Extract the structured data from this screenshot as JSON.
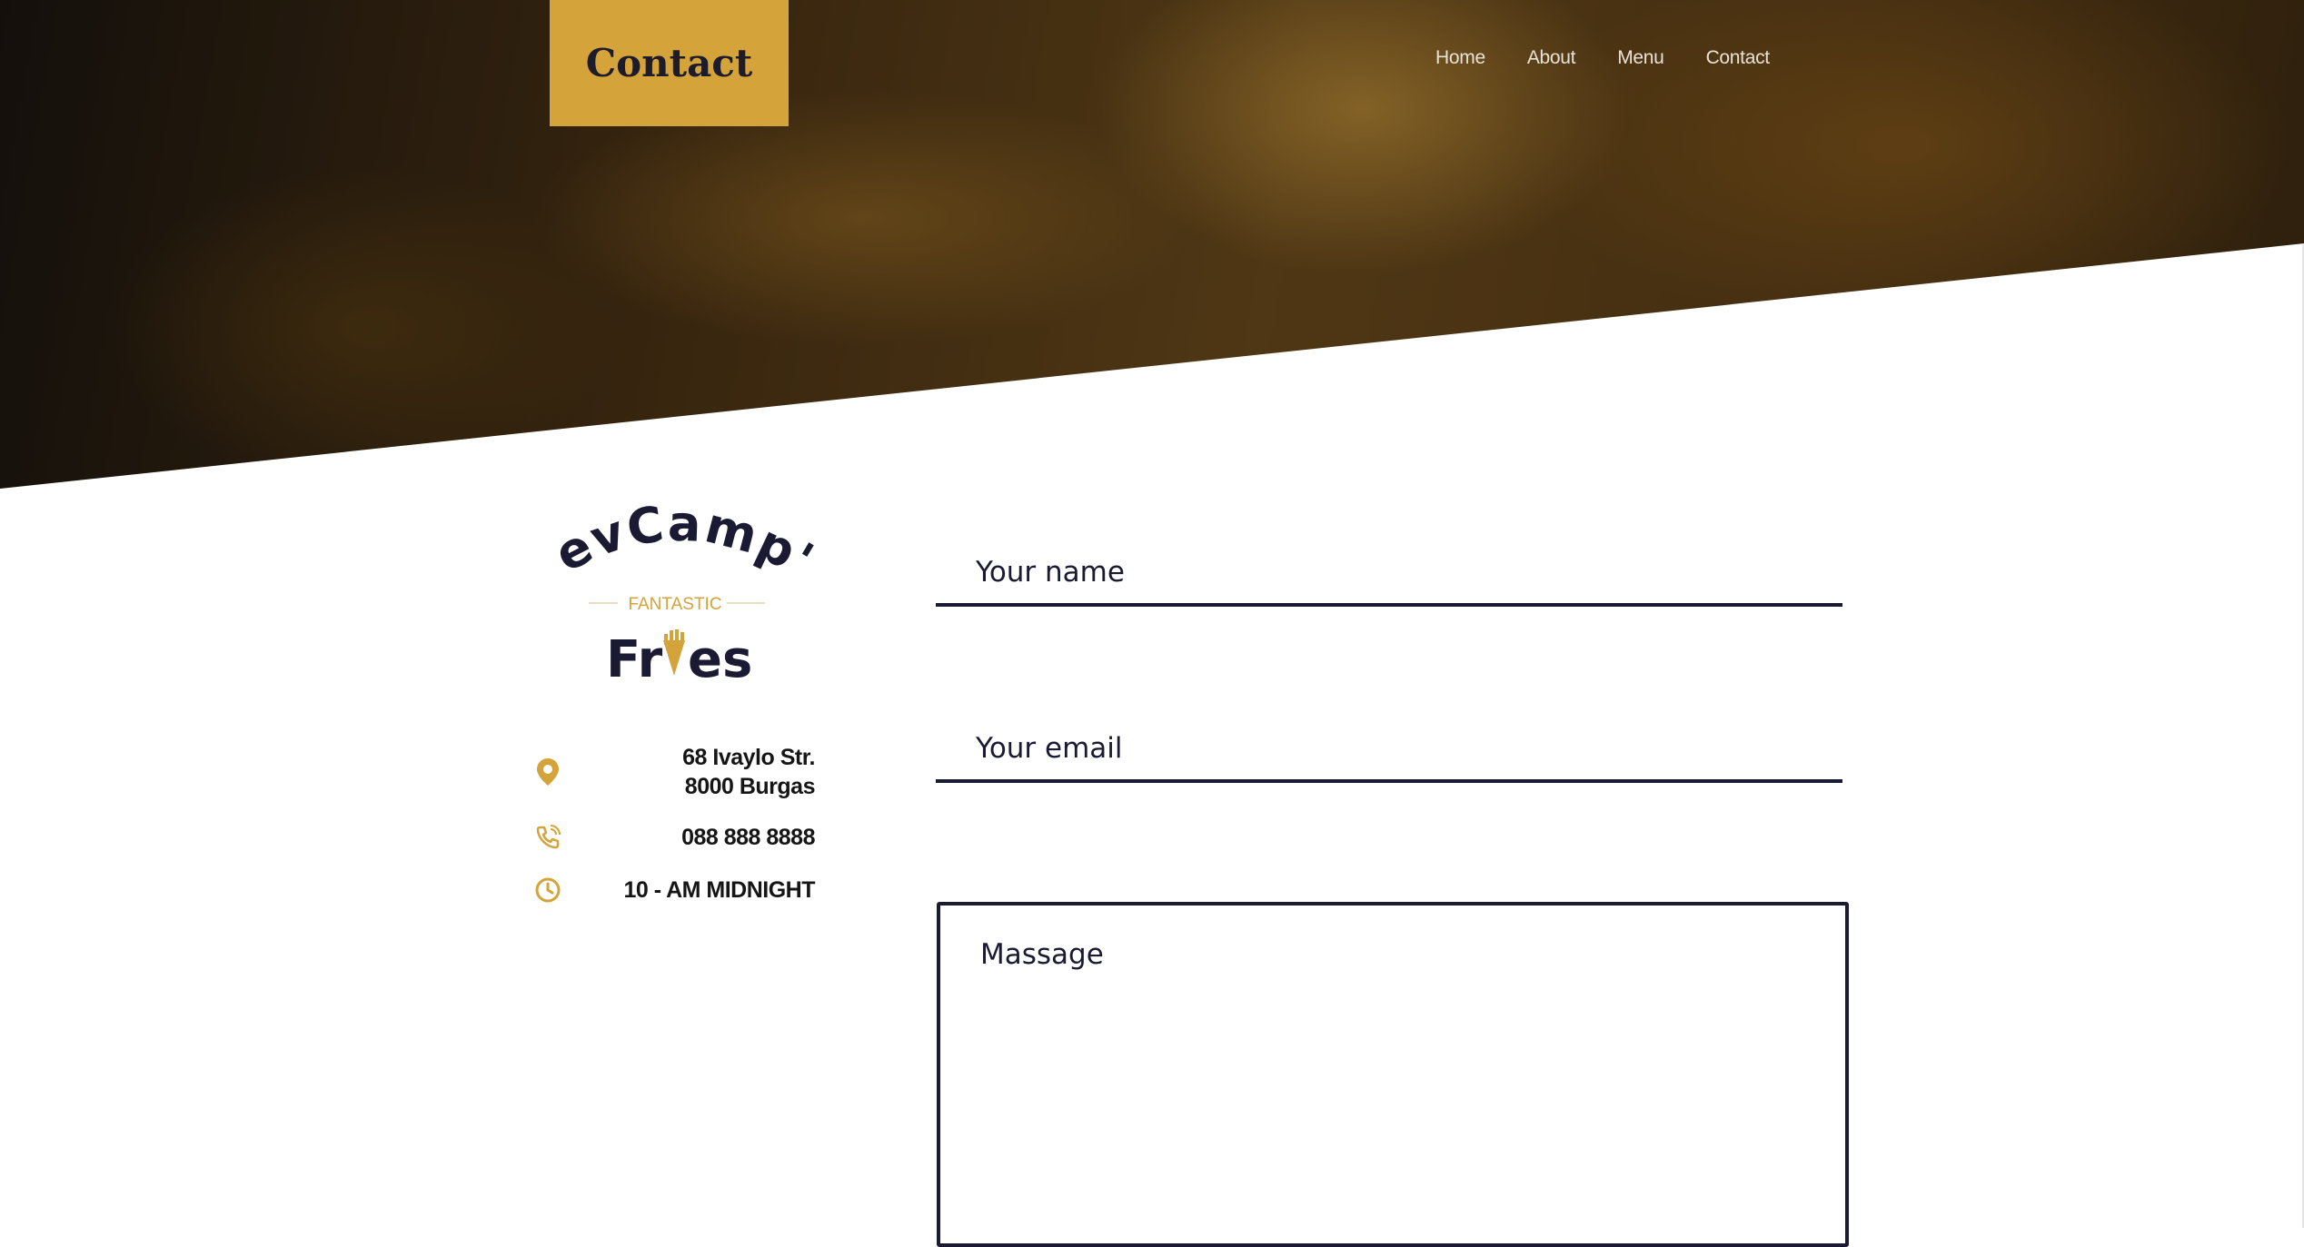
{
  "header": {
    "title": "Contact",
    "nav": [
      {
        "label": "Home"
      },
      {
        "label": "About"
      },
      {
        "label": "Menu"
      },
      {
        "label": "Contact"
      }
    ]
  },
  "logo": {
    "line1": "DevCamp's",
    "line2": "FANTASTIC",
    "line3_left": "Fr",
    "line3_right": "es"
  },
  "contact_info": {
    "address_line1": "68 Ivaylo Str.",
    "address_line2": "8000 Burgas",
    "phone": "088 888 8888",
    "hours": "10 - AM MIDNIGHT",
    "icons": [
      "location-pin-icon",
      "phone-icon",
      "clock-icon"
    ]
  },
  "form": {
    "name_placeholder": "Your name",
    "email_placeholder": "Your email",
    "message_placeholder": "Massage"
  },
  "colors": {
    "accent": "#d4a33a",
    "dark": "#1a1a33"
  }
}
